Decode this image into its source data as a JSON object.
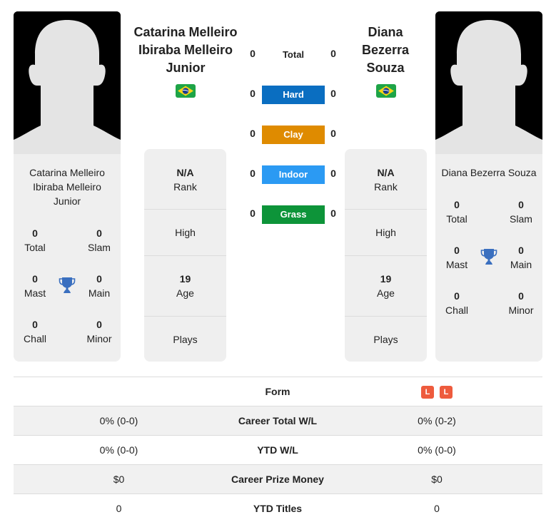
{
  "player_left": {
    "name": "Catarina Melleiro Ibiraba Melleiro Junior",
    "name_lines": [
      "Catarina Melleiro",
      "Ibiraba Melleiro",
      "Junior"
    ],
    "country_flag": "brazil-flag",
    "card_name_lines": [
      "Catarina Melleiro",
      "Ibiraba Melleiro",
      "Junior"
    ],
    "titles": {
      "total": {
        "value": "0",
        "label": "Total"
      },
      "slam": {
        "value": "0",
        "label": "Slam"
      },
      "mast": {
        "value": "0",
        "label": "Mast"
      },
      "main": {
        "value": "0",
        "label": "Main"
      },
      "chall": {
        "value": "0",
        "label": "Chall"
      },
      "minor": {
        "value": "0",
        "label": "Minor"
      }
    },
    "rank": {
      "value": "N/A",
      "label": "Rank"
    },
    "high": {
      "label": "High"
    },
    "age": {
      "value": "19",
      "label": "Age"
    },
    "plays": {
      "label": "Plays"
    }
  },
  "player_right": {
    "name": "Diana Bezerra Souza",
    "name_lines": [
      "Diana",
      "Bezerra",
      "Souza"
    ],
    "country_flag": "brazil-flag",
    "card_name_lines": [
      "Diana Bezerra Souza"
    ],
    "titles": {
      "total": {
        "value": "0",
        "label": "Total"
      },
      "slam": {
        "value": "0",
        "label": "Slam"
      },
      "mast": {
        "value": "0",
        "label": "Mast"
      },
      "main": {
        "value": "0",
        "label": "Main"
      },
      "chall": {
        "value": "0",
        "label": "Chall"
      },
      "minor": {
        "value": "0",
        "label": "Minor"
      }
    },
    "rank": {
      "value": "N/A",
      "label": "Rank"
    },
    "high": {
      "label": "High"
    },
    "age": {
      "value": "19",
      "label": "Age"
    },
    "plays": {
      "label": "Plays"
    }
  },
  "h2h": [
    {
      "label": "Total",
      "left": "0",
      "right": "0",
      "color": null
    },
    {
      "label": "Hard",
      "left": "0",
      "right": "0",
      "color": "#0a6ec1"
    },
    {
      "label": "Clay",
      "left": "0",
      "right": "0",
      "color": "#df8b00"
    },
    {
      "label": "Indoor",
      "left": "0",
      "right": "0",
      "color": "#2b9af3"
    },
    {
      "label": "Grass",
      "left": "0",
      "right": "0",
      "color": "#0d9439"
    }
  ],
  "comparison": {
    "form": {
      "label": "Form",
      "left": [],
      "right": [
        "L",
        "L"
      ]
    },
    "rows": [
      {
        "label": "Career Total W/L",
        "left": "0% (0-0)",
        "right": "0% (0-2)"
      },
      {
        "label": "YTD W/L",
        "left": "0% (0-0)",
        "right": "0% (0-0)"
      },
      {
        "label": "Career Prize Money",
        "left": "$0",
        "right": "$0"
      },
      {
        "label": "YTD Titles",
        "left": "0",
        "right": "0"
      }
    ]
  },
  "colors": {
    "loss_badge": "#ee5b3d",
    "trophy": "#3a6fbf",
    "card_bg": "#efefef"
  }
}
